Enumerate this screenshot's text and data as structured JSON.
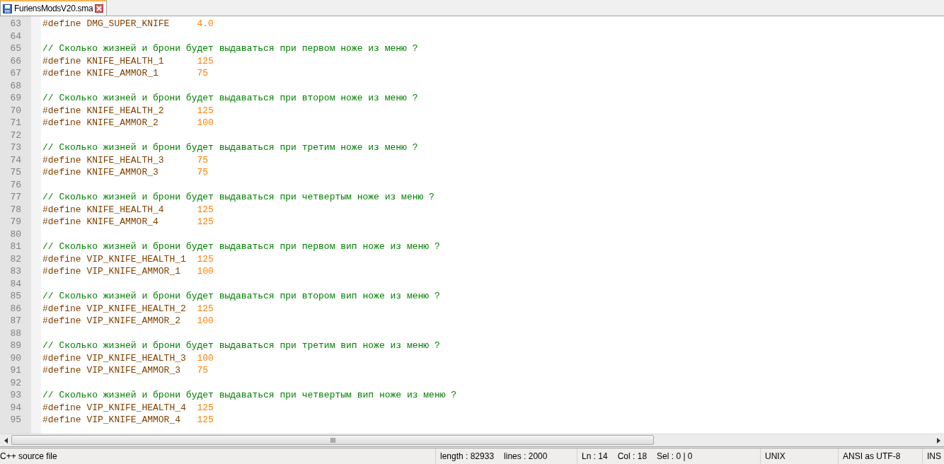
{
  "tabs": [
    {
      "label": "FuriensModsV20.sma",
      "selected": true
    }
  ],
  "lines": [
    {
      "number": "63",
      "kind": "define",
      "keyword": "#define",
      "name": "DMG_SUPER_KNIFE",
      "value": "4.0"
    },
    {
      "number": "64",
      "kind": "blank"
    },
    {
      "number": "65",
      "kind": "comment",
      "text": "// Сколько жизней и брони будет выдаваться при первом ноже из меню ?"
    },
    {
      "number": "66",
      "kind": "define",
      "keyword": "#define",
      "name": "KNIFE_HEALTH_1",
      "value": "125"
    },
    {
      "number": "67",
      "kind": "define",
      "keyword": "#define",
      "name": "KNIFE_AMMOR_1",
      "value": "75"
    },
    {
      "number": "68",
      "kind": "blank"
    },
    {
      "number": "69",
      "kind": "comment",
      "text": "// Сколько жизней и брони будет выдаваться при втором ноже из меню ?"
    },
    {
      "number": "70",
      "kind": "define",
      "keyword": "#define",
      "name": "KNIFE_HEALTH_2",
      "value": "125"
    },
    {
      "number": "71",
      "kind": "define",
      "keyword": "#define",
      "name": "KNIFE_AMMOR_2",
      "value": "100"
    },
    {
      "number": "72",
      "kind": "blank"
    },
    {
      "number": "73",
      "kind": "comment",
      "text": "// Сколько жизней и брони будет выдаваться при третим ноже из меню ?"
    },
    {
      "number": "74",
      "kind": "define",
      "keyword": "#define",
      "name": "KNIFE_HEALTH_3",
      "value": "75"
    },
    {
      "number": "75",
      "kind": "define",
      "keyword": "#define",
      "name": "KNIFE_AMMOR_3",
      "value": "75"
    },
    {
      "number": "76",
      "kind": "blank"
    },
    {
      "number": "77",
      "kind": "comment",
      "text": "// Сколько жизней и брони будет выдаваться при четвертым ноже из меню ?"
    },
    {
      "number": "78",
      "kind": "define",
      "keyword": "#define",
      "name": "KNIFE_HEALTH_4",
      "value": "125"
    },
    {
      "number": "79",
      "kind": "define",
      "keyword": "#define",
      "name": "KNIFE_AMMOR_4",
      "value": "125"
    },
    {
      "number": "80",
      "kind": "blank"
    },
    {
      "number": "81",
      "kind": "comment",
      "text": "// Сколько жизней и брони будет выдаваться при первом вип ноже из меню ?"
    },
    {
      "number": "82",
      "kind": "define",
      "keyword": "#define",
      "name": "VIP_KNIFE_HEALTH_1",
      "value": "125"
    },
    {
      "number": "83",
      "kind": "define",
      "keyword": "#define",
      "name": "VIP_KNIFE_AMMOR_1",
      "value": "100"
    },
    {
      "number": "84",
      "kind": "blank"
    },
    {
      "number": "85",
      "kind": "comment",
      "text": "// Сколько жизней и брони будет выдаваться при втором вип ноже из меню ?"
    },
    {
      "number": "86",
      "kind": "define",
      "keyword": "#define",
      "name": "VIP_KNIFE_HEALTH_2",
      "value": "125"
    },
    {
      "number": "87",
      "kind": "define",
      "keyword": "#define",
      "name": "VIP_KNIFE_AMMOR_2",
      "value": "100"
    },
    {
      "number": "88",
      "kind": "blank"
    },
    {
      "number": "89",
      "kind": "comment",
      "text": "// Сколько жизней и брони будет выдаваться при третим вип ноже из меню ?"
    },
    {
      "number": "90",
      "kind": "define",
      "keyword": "#define",
      "name": "VIP_KNIFE_HEALTH_3",
      "value": "100"
    },
    {
      "number": "91",
      "kind": "define",
      "keyword": "#define",
      "name": "VIP_KNIFE_AMMOR_3",
      "value": "75"
    },
    {
      "number": "92",
      "kind": "blank"
    },
    {
      "number": "93",
      "kind": "comment",
      "text": "// Сколько жизней и брони будет выдаваться при четвертым вип ноже из меню ?"
    },
    {
      "number": "94",
      "kind": "define",
      "keyword": "#define",
      "name": "VIP_KNIFE_HEALTH_4",
      "value": "125"
    },
    {
      "number": "95",
      "kind": "define",
      "keyword": "#define",
      "name": "VIP_KNIFE_AMMOR_4",
      "value": "125"
    }
  ],
  "status_bar": {
    "file_type": "C++ source file",
    "length": "length : 82933",
    "lines": "lines : 2000",
    "ln": "Ln : 14",
    "col": "Col : 18",
    "sel": "Sel : 0 | 0",
    "eol": "UNIX",
    "encoding": "ANSI as UTF-8",
    "mode": "INS"
  }
}
